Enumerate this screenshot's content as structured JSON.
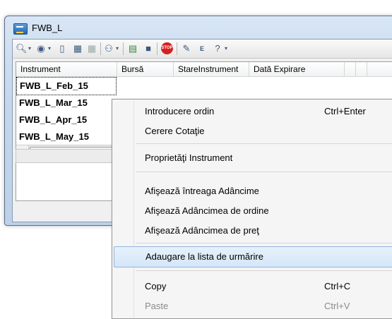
{
  "window": {
    "title": "FWB_L"
  },
  "grid": {
    "columns": [
      "Instrument",
      "Bursă",
      "StareInstrument",
      "Dată Expirare"
    ],
    "rows": [
      {
        "instrument": "FWB_L_Feb_15"
      },
      {
        "instrument": "FWB_L_Mar_15"
      },
      {
        "instrument": "FWB_L_Apr_15"
      },
      {
        "instrument": "FWB_L_May_15"
      }
    ]
  },
  "context_menu": {
    "items": [
      {
        "label": "Introducere ordin",
        "shortcut": "Ctrl+Enter"
      },
      {
        "label": "Cerere Cotaţie"
      },
      {
        "label": "Proprietăţi Instrument"
      },
      {
        "label": "Afişează întreaga Adâncime"
      },
      {
        "label": "Afişează Adâncimea de ordine"
      },
      {
        "label": "Afişează Adâncimea de preţ"
      },
      {
        "label": "Adaugare la lista de urmărire",
        "highlighted": true
      },
      {
        "label": "Copy",
        "shortcut": "Ctrl+C"
      },
      {
        "label": "Paste",
        "shortcut": "Ctrl+V",
        "disabled": true
      }
    ]
  },
  "toolbar": {
    "icons": [
      "search-icon",
      "eye-icon",
      "document-icon",
      "table-icon",
      "table-icon",
      "binoculars-icon",
      "chart-icon",
      "message-icon",
      "stop-icon",
      "edit-icon",
      "e-icon",
      "help-icon"
    ],
    "stop_label": "STOP"
  },
  "colors": {
    "highlight": "#d4e6f8",
    "title_bg": "#c3d7ee"
  }
}
